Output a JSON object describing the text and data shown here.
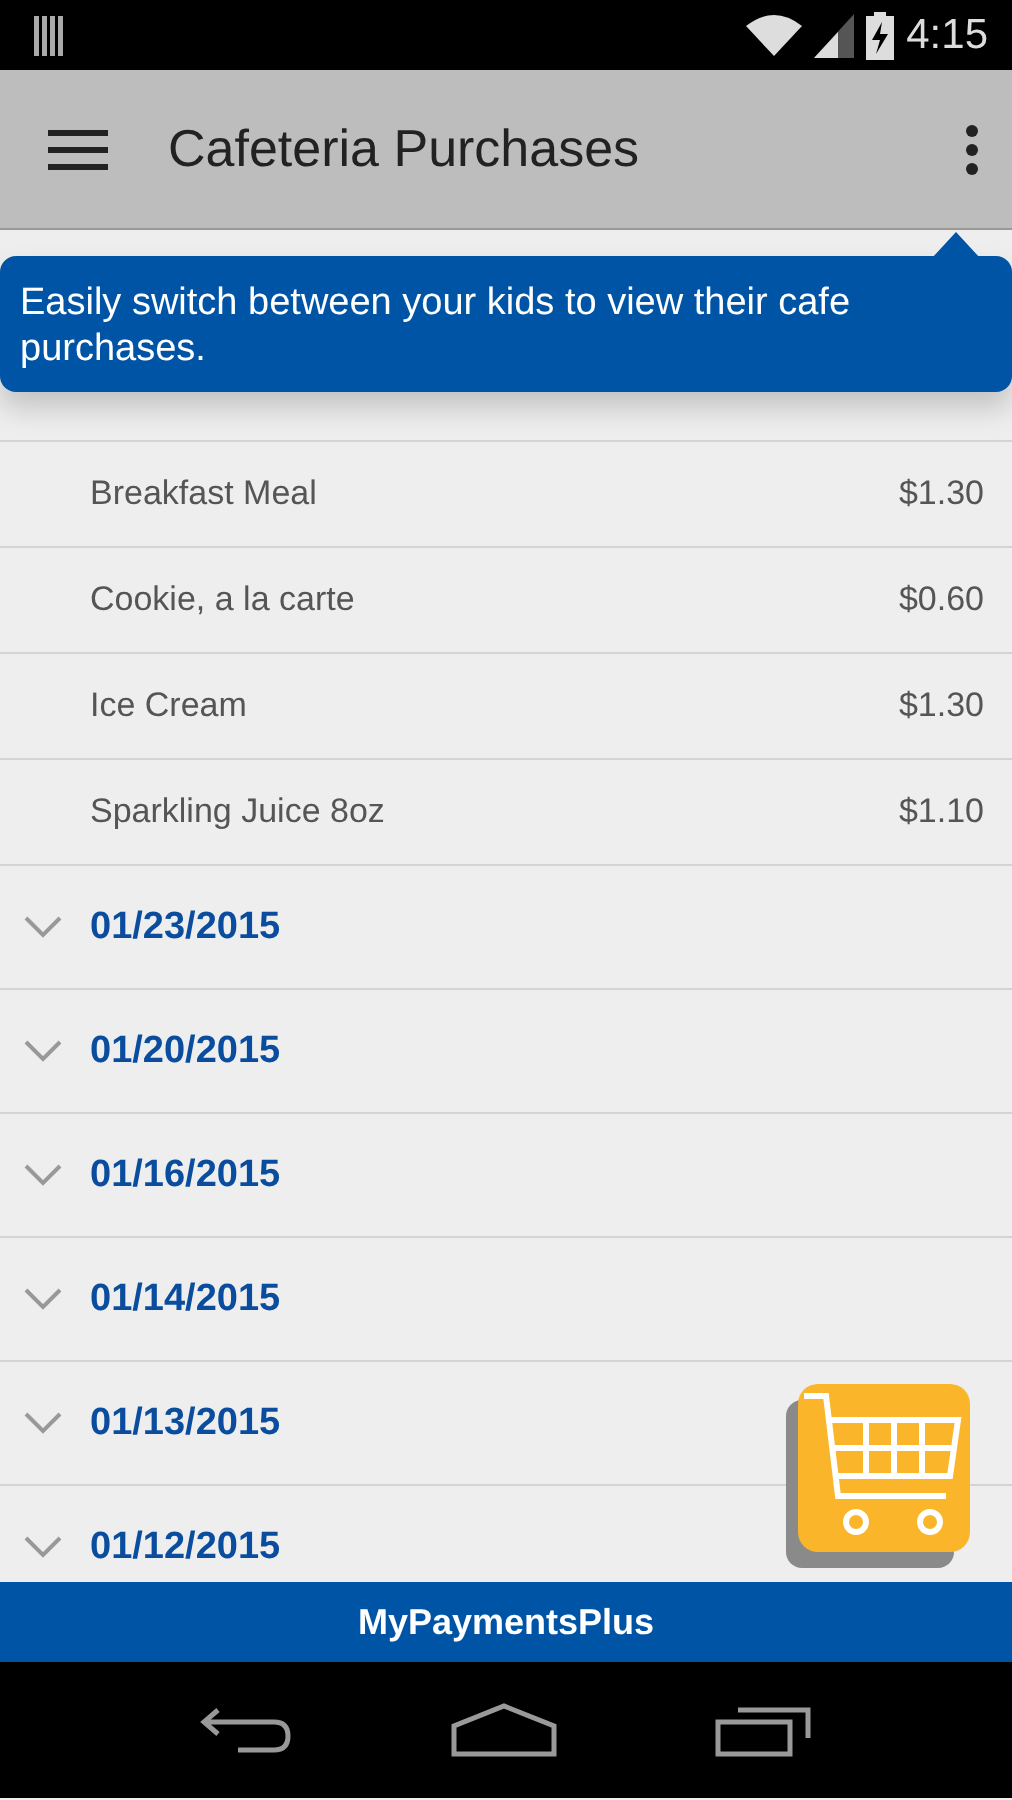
{
  "status_bar": {
    "time": "4:15"
  },
  "app_bar": {
    "title": "Cafeteria Purchases"
  },
  "tooltip": {
    "text": "Easily switch between your kids to view their cafe purchases."
  },
  "groups": [
    {
      "expanded": true,
      "items": [
        {
          "name": "Breakfast Meal",
          "price": "$1.30"
        },
        {
          "name": "Cookie, a la carte",
          "price": "$0.60"
        },
        {
          "name": "Ice Cream",
          "price": "$1.30"
        },
        {
          "name": "Sparkling Juice 8oz",
          "price": "$1.10"
        }
      ]
    },
    {
      "date": "01/23/2015",
      "expanded": false
    },
    {
      "date": "01/20/2015",
      "expanded": false
    },
    {
      "date": "01/16/2015",
      "expanded": false
    },
    {
      "date": "01/14/2015",
      "expanded": false
    },
    {
      "date": "01/13/2015",
      "expanded": false
    },
    {
      "date": "01/12/2015",
      "expanded": false
    }
  ],
  "footer": {
    "brand": "MyPaymentsPlus"
  }
}
